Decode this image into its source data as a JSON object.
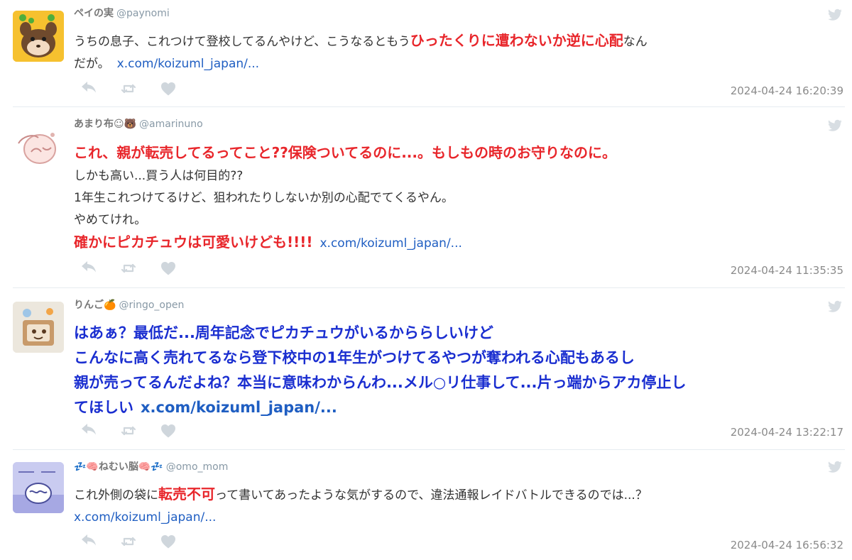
{
  "tweets": [
    {
      "name": "ペイの実",
      "handle": "@paynomi",
      "l1a": "うちの息子、これつけて登校してるんやけど、こうなるともう",
      "l1b": "ひったくりに遭わないか逆に心配",
      "l1c": "なん",
      "l2a": "だが。",
      "link": "x.com/koizuml_japan/...",
      "timestamp": "2024-04-24 16:20:39"
    },
    {
      "name": "あまり布☺🐻",
      "handle": "@amarinuno",
      "l1": "これ、親が転売してるってこと??保険ついてるのに...。もしもの時のお守りなのに。",
      "l2": "しかも高い...買う人は何目的??",
      "l3": "1年生これつけてるけど、狙われたりしないか別の心配でてくるやん。",
      "l4": "やめてけれ。",
      "l5": "確かにピカチュウは可愛いけども!!!!",
      "link": "x.com/koizuml_japan/...",
      "timestamp": "2024-04-24 11:35:35"
    },
    {
      "name": "りんご🍊",
      "handle": "@ringo_open",
      "l1": "はあぁ？最低だ...周年記念でピカチュウがいるかららしいけど",
      "l2": "こんなに高く売れてるなら登下校中の1年生がつけてるやつが奪われる心配もあるし",
      "l3": "親が売ってるんだよね？本当に意味わからんわ...メル○リ仕事して...片っ端からアカ停止し",
      "l4": "てほしい",
      "link": "x.com/koizuml_japan/...",
      "timestamp": "2024-04-24 13:22:17"
    },
    {
      "name": "💤🧠ねむい脳🧠💤",
      "handle": "@omo_mom",
      "l1a": "これ外側の袋に",
      "l1b": "転売不可",
      "l1c": "って書いてあったような気がするので、違法通報レイドバトルできるのでは...？",
      "link": "x.com/koizuml_japan/...",
      "timestamp": "2024-04-24 16:56:32"
    }
  ],
  "colors": {
    "red": "#e8262b",
    "blue": "#1a2ed0",
    "link": "#1f5ec2",
    "meta": "#8a8a8a"
  },
  "icons": [
    "reply-icon",
    "retweet-icon",
    "like-icon",
    "twitter-bird-icon"
  ]
}
